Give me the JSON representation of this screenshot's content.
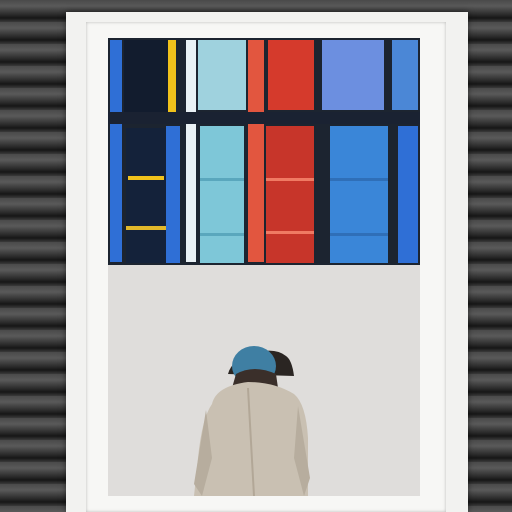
{
  "scene": {
    "colors": {
      "shutter": "#3a3a3a",
      "poster": "#f2f2f0",
      "wall": "#e4e1df",
      "glass_blue": "#2f6fd6",
      "glass_red": "#d53a2c",
      "glass_yellow": "#f1c21b",
      "frame_dark": "#1c2430",
      "coat": "#c9c0b2",
      "hair": "#3f7fa3"
    }
  }
}
